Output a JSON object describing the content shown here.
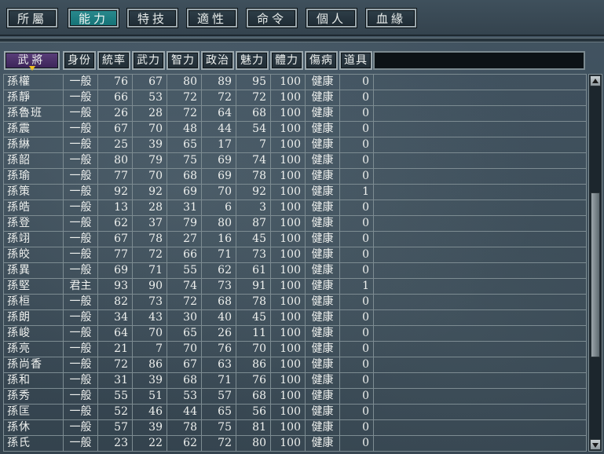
{
  "tabs": [
    {
      "label": "所屬",
      "active": false
    },
    {
      "label": "能力",
      "active": true
    },
    {
      "label": "特技",
      "active": false
    },
    {
      "label": "適性",
      "active": false
    },
    {
      "label": "命令",
      "active": false
    },
    {
      "label": "個人",
      "active": false
    },
    {
      "label": "血緣",
      "active": false
    }
  ],
  "columns": [
    "武將",
    "身份",
    "統率",
    "武力",
    "智力",
    "政治",
    "魅力",
    "體力",
    "傷病",
    "道具"
  ],
  "sorted_column": "武將",
  "rows": [
    [
      "孫權",
      "一般",
      "76",
      "67",
      "80",
      "89",
      "95",
      "100",
      "健康",
      "0"
    ],
    [
      "孫靜",
      "一般",
      "66",
      "53",
      "72",
      "72",
      "72",
      "100",
      "健康",
      "0"
    ],
    [
      "孫魯班",
      "一般",
      "26",
      "28",
      "72",
      "64",
      "68",
      "100",
      "健康",
      "0"
    ],
    [
      "孫震",
      "一般",
      "67",
      "70",
      "48",
      "44",
      "54",
      "100",
      "健康",
      "0"
    ],
    [
      "孫綝",
      "一般",
      "25",
      "39",
      "65",
      "17",
      "7",
      "100",
      "健康",
      "0"
    ],
    [
      "孫韶",
      "一般",
      "80",
      "79",
      "75",
      "69",
      "74",
      "100",
      "健康",
      "0"
    ],
    [
      "孫瑜",
      "一般",
      "77",
      "70",
      "68",
      "69",
      "78",
      "100",
      "健康",
      "0"
    ],
    [
      "孫策",
      "一般",
      "92",
      "92",
      "69",
      "70",
      "92",
      "100",
      "健康",
      "1"
    ],
    [
      "孫皓",
      "一般",
      "13",
      "28",
      "31",
      "6",
      "3",
      "100",
      "健康",
      "0"
    ],
    [
      "孫登",
      "一般",
      "62",
      "37",
      "79",
      "80",
      "87",
      "100",
      "健康",
      "0"
    ],
    [
      "孫翊",
      "一般",
      "67",
      "78",
      "27",
      "16",
      "45",
      "100",
      "健康",
      "0"
    ],
    [
      "孫皎",
      "一般",
      "77",
      "72",
      "66",
      "71",
      "73",
      "100",
      "健康",
      "0"
    ],
    [
      "孫異",
      "一般",
      "69",
      "71",
      "55",
      "62",
      "61",
      "100",
      "健康",
      "0"
    ],
    [
      "孫堅",
      "君主",
      "93",
      "90",
      "74",
      "73",
      "91",
      "100",
      "健康",
      "1"
    ],
    [
      "孫桓",
      "一般",
      "82",
      "73",
      "72",
      "68",
      "78",
      "100",
      "健康",
      "0"
    ],
    [
      "孫朗",
      "一般",
      "34",
      "43",
      "30",
      "40",
      "45",
      "100",
      "健康",
      "0"
    ],
    [
      "孫峻",
      "一般",
      "64",
      "70",
      "65",
      "26",
      "11",
      "100",
      "健康",
      "0"
    ],
    [
      "孫亮",
      "一般",
      "21",
      "7",
      "70",
      "76",
      "70",
      "100",
      "健康",
      "0"
    ],
    [
      "孫尚香",
      "一般",
      "72",
      "86",
      "67",
      "63",
      "86",
      "100",
      "健康",
      "0"
    ],
    [
      "孫和",
      "一般",
      "31",
      "39",
      "68",
      "71",
      "76",
      "100",
      "健康",
      "0"
    ],
    [
      "孫秀",
      "一般",
      "55",
      "51",
      "53",
      "57",
      "68",
      "100",
      "健康",
      "0"
    ],
    [
      "孫匡",
      "一般",
      "52",
      "46",
      "44",
      "65",
      "56",
      "100",
      "健康",
      "0"
    ],
    [
      "孫休",
      "一般",
      "57",
      "39",
      "78",
      "75",
      "81",
      "100",
      "健康",
      "0"
    ],
    [
      "孫氏",
      "一般",
      "23",
      "22",
      "62",
      "72",
      "80",
      "100",
      "健康",
      "0"
    ]
  ]
}
